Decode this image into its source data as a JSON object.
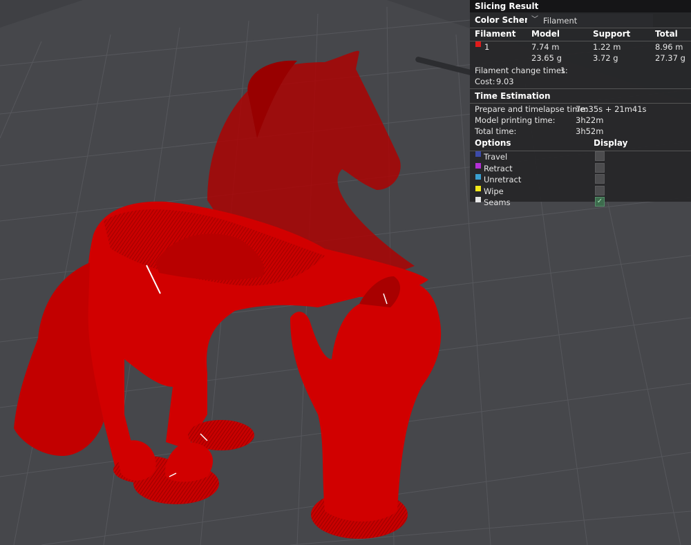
{
  "panel": {
    "title": "Slicing Result",
    "color_scheme": {
      "label": "Color Scheme",
      "value": "Filament"
    },
    "filament_table": {
      "headers": [
        "Filament",
        "Model",
        "Support",
        "Total"
      ],
      "rows": [
        {
          "id": "1",
          "color": "#e01b1b",
          "model": [
            "7.74 m",
            "23.65 g"
          ],
          "support": [
            "1.22 m",
            "3.72 g"
          ],
          "total": [
            "8.96 m",
            "27.37 g"
          ]
        }
      ]
    },
    "filament_change": {
      "label": "Filament change times:",
      "value": "1"
    },
    "cost": {
      "label": "Cost:",
      "value": "9.03"
    },
    "time_estimation": {
      "title": "Time Estimation",
      "rows": [
        {
          "label": "Prepare and timelapse time:",
          "value": "7m35s + 21m41s"
        },
        {
          "label": "Model printing time:",
          "value": "3h22m"
        },
        {
          "label": "Total time:",
          "value": "3h52m"
        }
      ]
    },
    "options": {
      "headers": [
        "Options",
        "Display"
      ],
      "items": [
        {
          "label": "Travel",
          "color": "#3c4aa8",
          "checked": false
        },
        {
          "label": "Retract",
          "color": "#b42fd6",
          "checked": false
        },
        {
          "label": "Unretract",
          "color": "#3a9fd0",
          "checked": false
        },
        {
          "label": "Wipe",
          "color": "#f2e81a",
          "checked": false
        },
        {
          "label": "Seams",
          "color": "#e6e6e6",
          "checked": true
        }
      ]
    }
  },
  "colors": {
    "background": "#3f4044",
    "model_red": "#d10000",
    "grid": "#55565b"
  }
}
